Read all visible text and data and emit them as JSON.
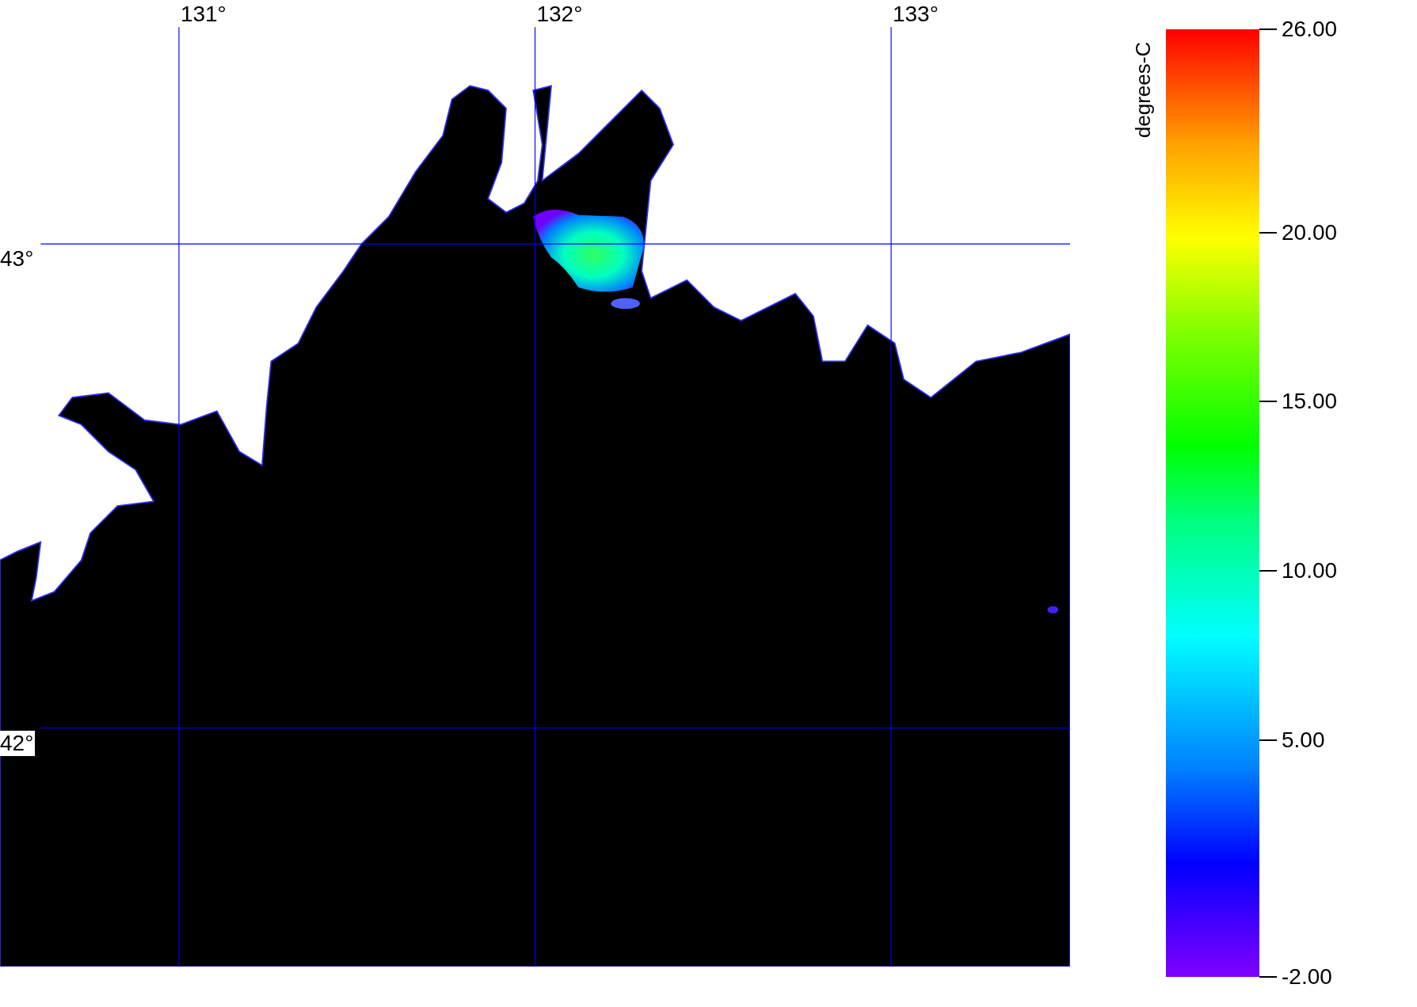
{
  "map": {
    "longitude_labels": [
      "131°",
      "132°",
      "133°"
    ],
    "latitude_labels": [
      "43°",
      "42°"
    ]
  },
  "colorbar": {
    "unit": "degrees-C",
    "ticks": [
      "26.00",
      "20.00",
      "15.00",
      "10.00",
      "5.00",
      "-2.00"
    ]
  }
}
